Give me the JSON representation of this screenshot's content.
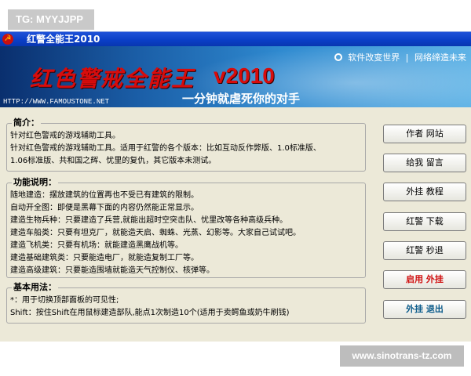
{
  "tag": {
    "text": "TG: MYYJJPP"
  },
  "window": {
    "title": "红警全能王2010",
    "title_icon": "hammer-sickle-icon"
  },
  "banner": {
    "links": [
      "软件改变世界",
      "网络缔造未来"
    ],
    "link_separator": "|",
    "title": "红色警戒全能王",
    "version": "v2010",
    "slogan": "一分钟就虐死你的对手",
    "url": "HTTP://WWW.FAMOUSTONE.NET"
  },
  "sections": {
    "intro": {
      "title": "简介：",
      "lines": [
        "针对红色警戒的游戏辅助工具。",
        "针对红色警戒的游戏辅助工具。适用于红警的各个版本：比如互动反作弊版、1.0标准版、",
        "1.06标准版、共和国之辉、忧里的复仇，其它版本未测试。"
      ]
    },
    "features": {
      "title": "功能说明：",
      "lines": [
        "随地建造：摆放建筑的位置再也不受已有建筑的限制。",
        "自动开全图：即便是黑幕下面的内容仍然能正常显示。",
        "建造生物兵种：只要建造了兵营,就能出超时空突击队、忧里改等各种高级兵种。",
        "建造车船类：只要有坦克厂，就能造天启、蜘蛛、光蒸、幻影等。大家自己试试吧。",
        "建造飞机类：只要有机场：就能建造黑鹰战机等。",
        "建造基础建筑类：只要能造电厂，就能造复制工厂等。",
        "建造高级建筑：只要能造围墙就能造天气控制仪、核弹等。"
      ]
    },
    "usage": {
      "title": "基本用法：",
      "lines": [
        "*：用于切换顶部面板的可见性;",
        "Shift：按住Shift在用鼠标建造部队,能点1次制造10个(适用于卖鳄鱼或奶牛刷钱)"
      ]
    }
  },
  "buttons": {
    "author_site": "作者 网站",
    "leave_message": "给我 留言",
    "tutorial": "外挂 教程",
    "download": "红警 下载",
    "quit_game": "红警 秒退",
    "enable_hack": "启用 外挂",
    "exit_hack": "外挂 退出"
  },
  "colors": {
    "accent_red": "#d01010",
    "accent_blue": "#0a5a8a",
    "titlebar": "#0a3ec5"
  },
  "watermark": {
    "text": "www.sinotrans-tz.com"
  }
}
